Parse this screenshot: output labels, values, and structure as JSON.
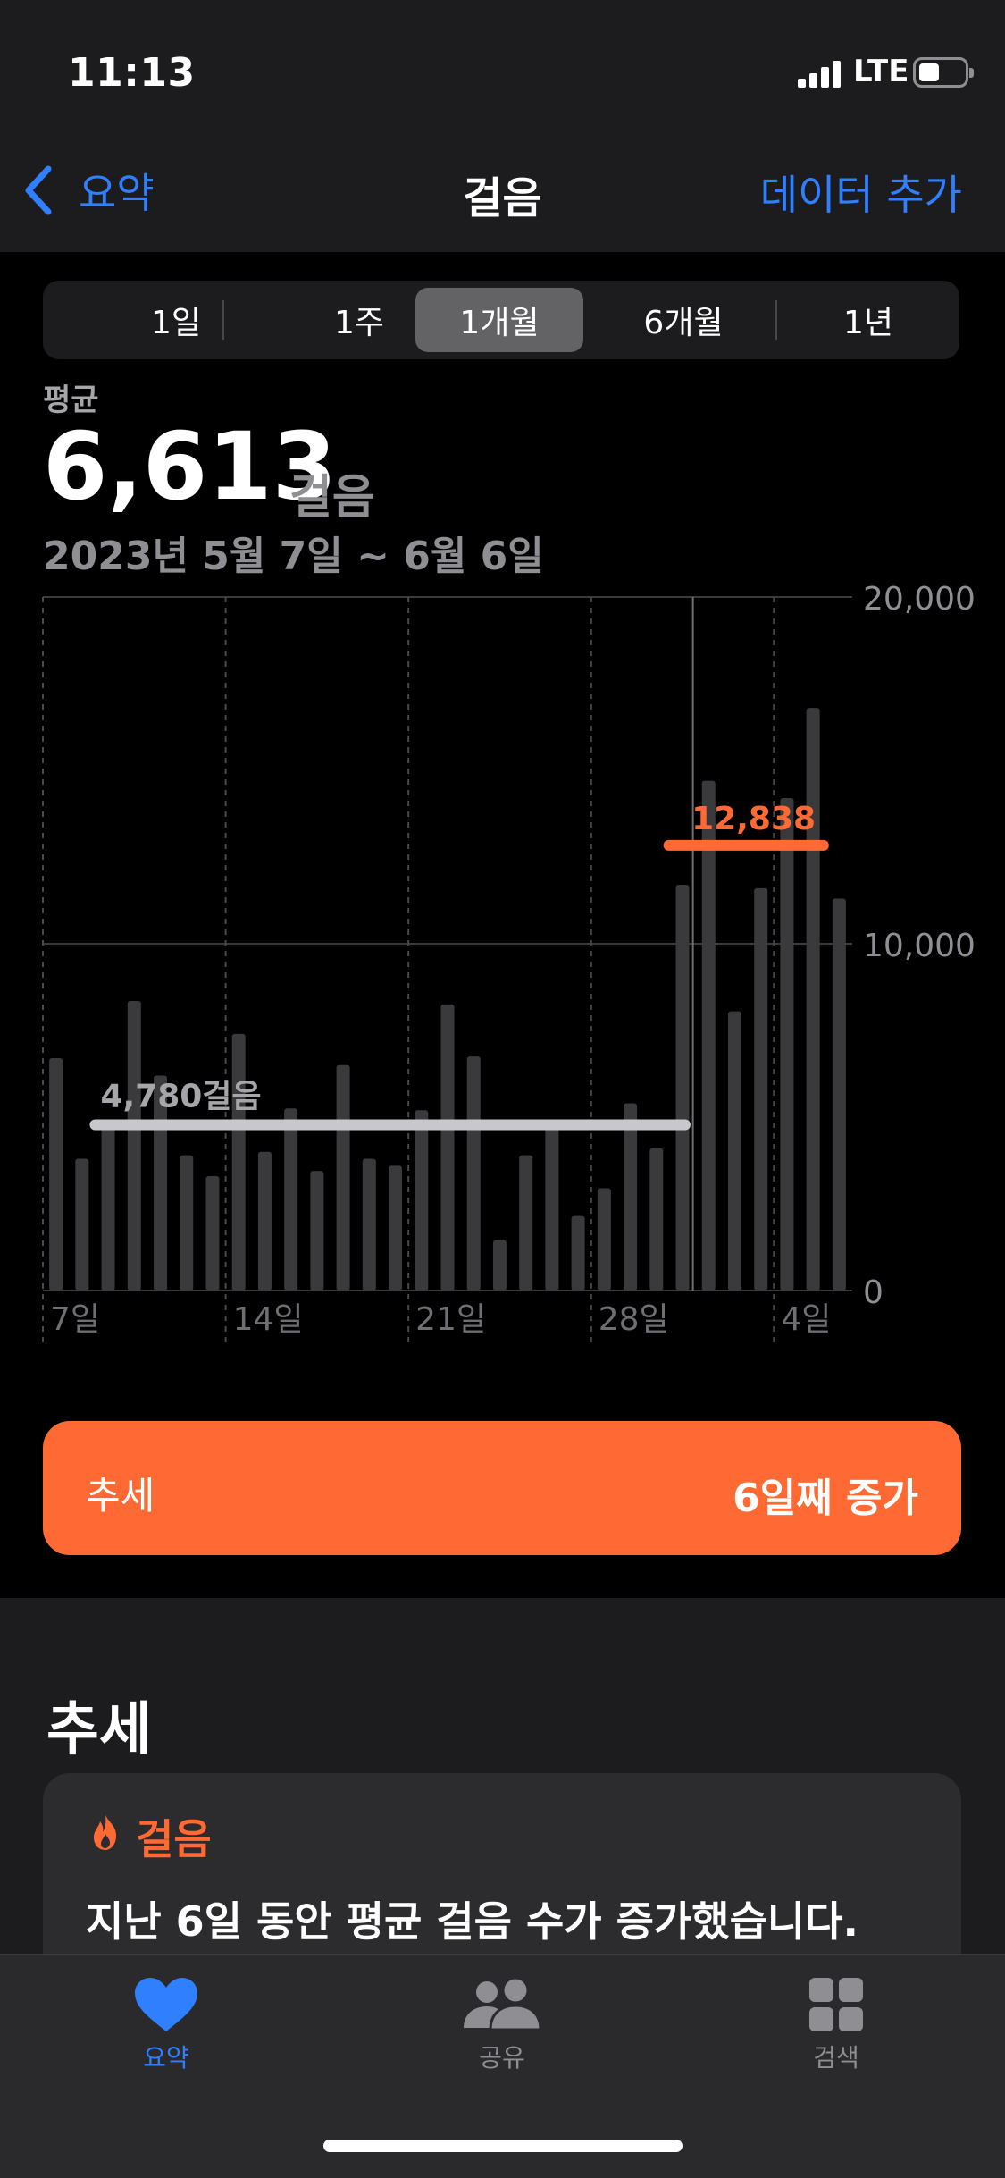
{
  "status_bar": {
    "time": "11:13",
    "network": "LTE"
  },
  "nav": {
    "back_label": "요약",
    "title": "걸음",
    "add_label": "데이터 추가"
  },
  "segments": {
    "items": [
      "1일",
      "1주",
      "1개월",
      "6개월",
      "1년"
    ],
    "selected": "1개월"
  },
  "summary": {
    "avg_label": "평균",
    "avg_value": "6,613",
    "avg_unit": "걸음",
    "date_range": "2023년 5월 7일 ~ 6월 6일"
  },
  "chart_data": {
    "type": "bar",
    "categories": [
      "5/7",
      "5/8",
      "5/9",
      "5/10",
      "5/11",
      "5/12",
      "5/13",
      "5/14",
      "5/15",
      "5/16",
      "5/17",
      "5/18",
      "5/19",
      "5/20",
      "5/21",
      "5/22",
      "5/23",
      "5/24",
      "5/25",
      "5/26",
      "5/27",
      "5/28",
      "5/29",
      "5/30",
      "5/31",
      "6/1",
      "6/2",
      "6/3",
      "6/4",
      "6/5",
      "6/6"
    ],
    "values": [
      6700,
      3800,
      4800,
      8350,
      6200,
      3900,
      3300,
      7400,
      4000,
      5250,
      3450,
      6500,
      3800,
      3600,
      5200,
      8250,
      6750,
      1450,
      3900,
      4800,
      2150,
      2950,
      5400,
      4100,
      11700,
      14700,
      8050,
      11600,
      14200,
      16800,
      11300
    ],
    "x_tick_labels": [
      "7일",
      "14일",
      "21일",
      "28일",
      "4일"
    ],
    "y_tick_labels": [
      "20,000",
      "10,000",
      "0"
    ],
    "ylim": [
      0,
      20000
    ],
    "grid": true,
    "baseline": {
      "label": "4,780걸음",
      "value": 4780
    },
    "recent_avg": {
      "label": "12,838",
      "value": 12838
    },
    "bar_color": "#3a3a3c",
    "baseline_color": "#c7c7cc",
    "accent_color": "#ff6a34"
  },
  "trend_button": {
    "label": "추세",
    "value": "6일째 증가"
  },
  "trends_section": {
    "title": "추세",
    "card": {
      "icon": "flame-icon",
      "category": "걸음",
      "text": "지난 6일 동안 평균 걸음 수가 증가했습니다."
    }
  },
  "tab_bar": {
    "items": [
      {
        "label": "요약",
        "icon": "heart-icon",
        "active": true
      },
      {
        "label": "공유",
        "icon": "people-icon",
        "active": false
      },
      {
        "label": "검색",
        "icon": "grid-icon",
        "active": false
      }
    ]
  },
  "colors": {
    "accent": "#2f7fff",
    "trend": "#ff6a34",
    "background": "#000000",
    "card": "#2c2c2e"
  }
}
